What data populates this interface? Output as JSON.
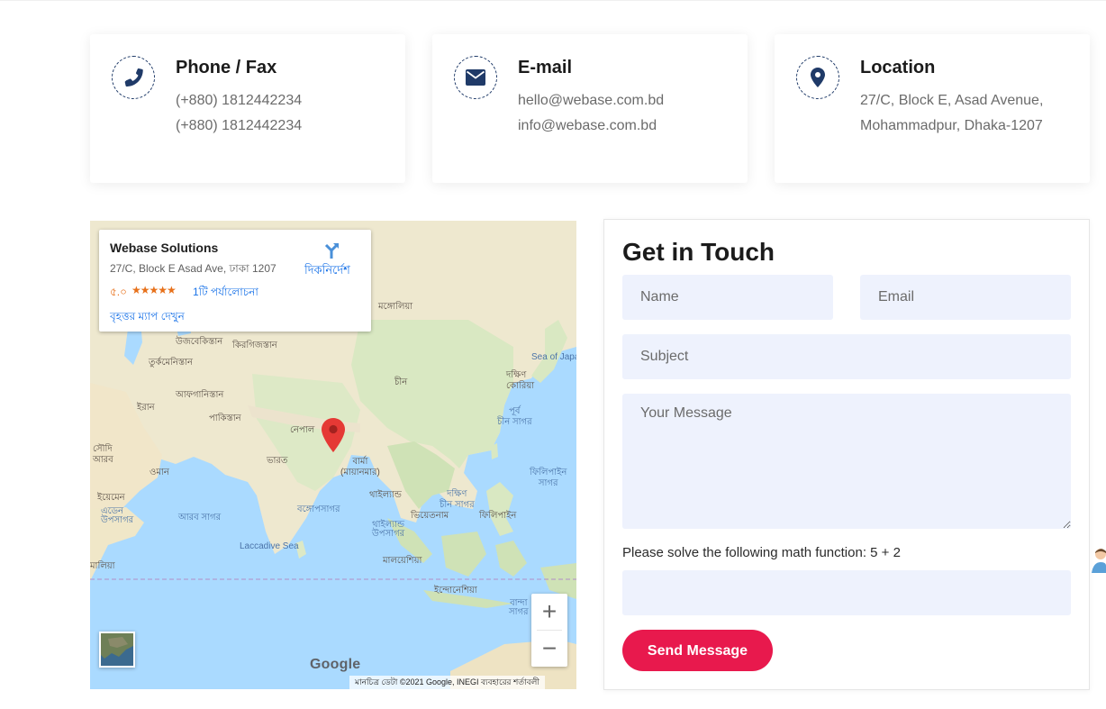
{
  "contact_cards": [
    {
      "title": "Phone / Fax",
      "icon": "phone-icon",
      "lines": [
        "(+880) 1812442234",
        "(+880) 1812442234"
      ]
    },
    {
      "title": "E-mail",
      "icon": "envelope-icon",
      "lines": [
        "hello@webase.com.bd",
        "info@webase.com.bd"
      ]
    },
    {
      "title": "Location",
      "icon": "map-pin-icon",
      "lines": [
        "27/C, Block E, Asad Avenue,",
        "Mohammadpur, Dhaka-1207"
      ]
    }
  ],
  "map": {
    "place_name": "Webase Solutions",
    "address": "27/C, Block E Asad Ave, ঢাকা 1207",
    "rating": "৫.০",
    "stars": "★★★★★",
    "reviews": "1টি পর্যালোচনা",
    "view_larger": "বৃহত্তর ম্যাপ দেখুন",
    "directions": "দিকনির্দেশ",
    "zoom_in": "+",
    "zoom_out": "−",
    "google": "Google",
    "attribution": "মানচিত্র ডেটা ©2021 Google, INEGI     ব্যবহারের শর্তাবলী",
    "labels": {
      "mongolia": "মঙ্গোলিয়া",
      "uzbekistan": "উজবেকিস্তান",
      "kyrgyzstan": "কিরগিজস্তান",
      "turkmenistan": "তুর্কমেনিস্তান",
      "afghanistan": "আফগানিস্তান",
      "iran": "ইরান",
      "pakistan": "পাকিস্তান",
      "nepal": "নেপাল",
      "china": "চীন",
      "south_korea": "দক্ষিণ\nকোরিয়া",
      "sea_of_japan": "Sea of Japa",
      "east_china_sea": "পূর্ব\nচীন সাগর",
      "saudi": "সৌদি\nআরব",
      "oman": "ওমান",
      "india": "ভারত",
      "myanmar": "বার্মা\n(মায়ানমার)",
      "yemen": "ইয়েমেন",
      "gulf_aden": "এডেন\nউপসাগর",
      "arabian_sea": "আরব সাগর",
      "bay_bengal": "বঙ্গোপসাগর",
      "thailand": "থাইল্যান্ড",
      "south_china_sea": "দক্ষিণ\nচীন সাগর",
      "philippines": "ফিলিপাইন",
      "philippine_sea": "ফিলিপাইন\nসাগর",
      "vietnam": "ভিয়েতনাম",
      "gulf_thailand": "থাইল্যান্ড\nউপসাগর",
      "laccadive": "Laccadive Sea",
      "malaysia": "মালয়েশিয়া",
      "somalia": "মালিয়া",
      "indonesia": "ইন্দোনেশিয়া",
      "banda_sea": "বান্দা\nসাগর"
    }
  },
  "form": {
    "title": "Get in Touch",
    "name_placeholder": "Name",
    "email_placeholder": "Email",
    "subject_placeholder": "Subject",
    "message_placeholder": "Your Message",
    "math_prompt": "Please solve the following math function: 5 + 2",
    "answer_value": "",
    "submit_label": "Send Message"
  },
  "colors": {
    "accent": "#e8194d",
    "icon": "#1f3a68",
    "input_bg": "#eef2fd",
    "link": "#1a73e8",
    "pin": "#e53935"
  }
}
